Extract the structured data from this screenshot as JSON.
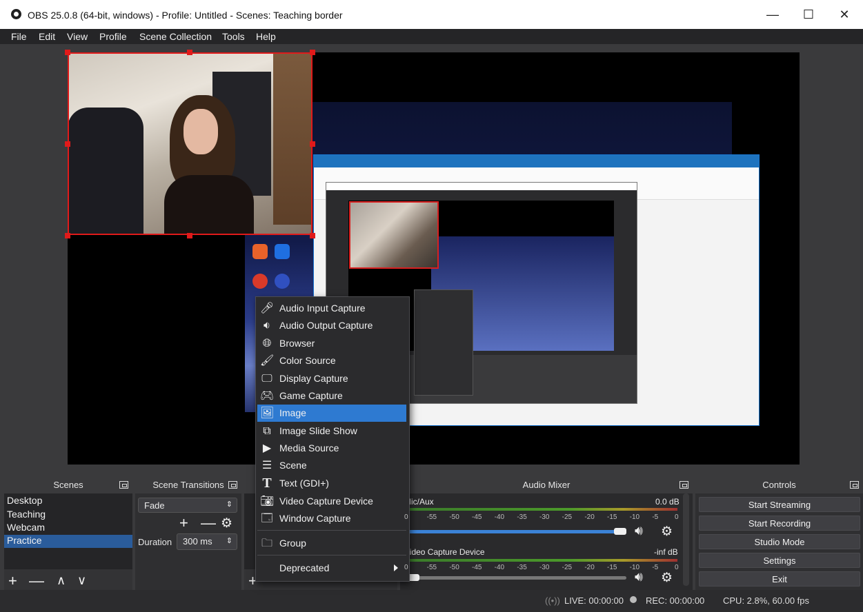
{
  "window": {
    "title": "OBS 25.0.8 (64-bit, windows) - Profile: Untitled - Scenes: Teaching border"
  },
  "menubar": [
    "File",
    "Edit",
    "View",
    "Profile",
    "Scene Collection",
    "Tools",
    "Help"
  ],
  "scenes": {
    "title": "Scenes",
    "items": [
      "Desktop",
      "Teaching",
      "Webcam",
      "Practice"
    ],
    "selected": "Practice"
  },
  "transitions": {
    "title": "Scene Transitions",
    "type": "Fade",
    "duration_label": "Duration",
    "duration_value": "300 ms"
  },
  "audio_mixer": {
    "title": "Audio Mixer",
    "channels": [
      {
        "name": "Mic/Aux",
        "level": "0.0 dB",
        "fader_fraction": 1.0
      },
      {
        "name": "Video Capture Device",
        "level": "-inf dB",
        "fader_fraction": 0.0
      }
    ],
    "scale_ticks": [
      "0",
      "-55",
      "-50",
      "-45",
      "-40",
      "-35",
      "-30",
      "-25",
      "-20",
      "-15",
      "-10",
      "-5",
      "0"
    ]
  },
  "controls": {
    "title": "Controls",
    "buttons": [
      "Start Streaming",
      "Start Recording",
      "Studio Mode",
      "Settings",
      "Exit"
    ]
  },
  "status": {
    "live": "LIVE: 00:00:00",
    "rec": "REC: 00:00:00",
    "cpu": "CPU: 2.8%, 60.00 fps"
  },
  "context_menu": {
    "items": [
      {
        "label": "Audio Input Capture",
        "icon": "microphone-icon"
      },
      {
        "label": "Audio Output Capture",
        "icon": "speaker-icon"
      },
      {
        "label": "Browser",
        "icon": "globe-icon"
      },
      {
        "label": "Color Source",
        "icon": "brush-icon"
      },
      {
        "label": "Display Capture",
        "icon": "monitor-icon"
      },
      {
        "label": "Game Capture",
        "icon": "gamepad-icon"
      },
      {
        "label": "Image",
        "icon": "image-icon"
      },
      {
        "label": "Image Slide Show",
        "icon": "slideshow-icon"
      },
      {
        "label": "Media Source",
        "icon": "play-icon"
      },
      {
        "label": "Scene",
        "icon": "list-icon"
      },
      {
        "label": "Text (GDI+)",
        "icon": "text-icon"
      },
      {
        "label": "Video Capture Device",
        "icon": "camera-icon"
      },
      {
        "label": "Window Capture",
        "icon": "window-icon"
      },
      {
        "label": "Group",
        "icon": "folder-icon"
      },
      {
        "label": "Deprecated",
        "icon": ""
      }
    ],
    "highlighted": "Image"
  },
  "colors": {
    "accent": "#2e7ad1",
    "selection": "#e01a1a",
    "background": "#3a3a3c"
  }
}
